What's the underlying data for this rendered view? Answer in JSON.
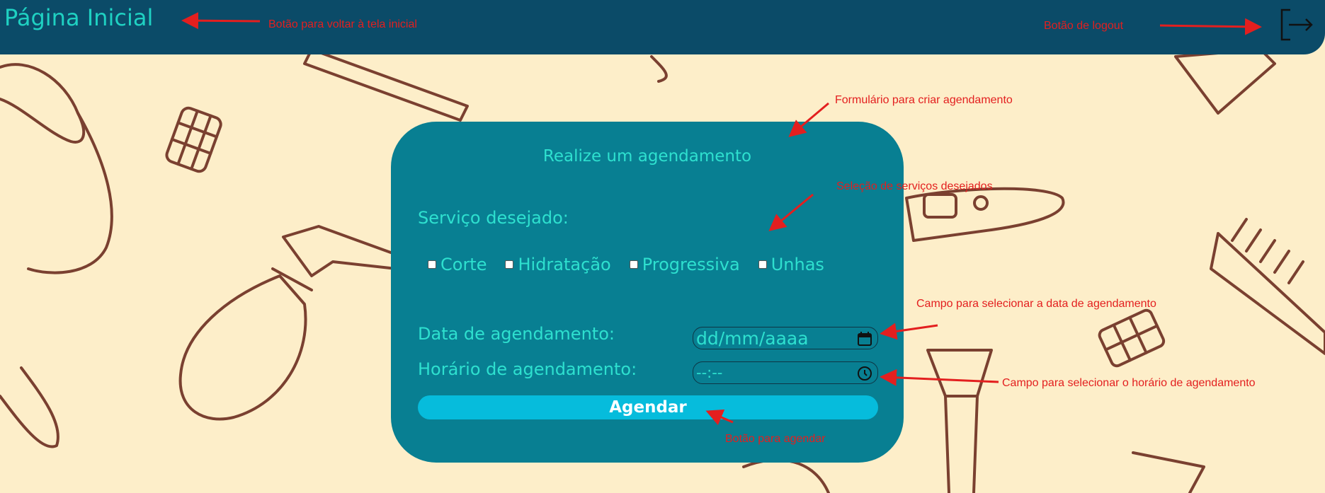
{
  "header": {
    "home_label": "Página Inicial",
    "logout_icon": "logout-icon"
  },
  "form": {
    "title": "Realize um agendamento",
    "service_label": "Serviço desejado:",
    "services": [
      {
        "label": "Corte",
        "checked": false
      },
      {
        "label": "Hidratação",
        "checked": false
      },
      {
        "label": "Progressiva",
        "checked": false
      },
      {
        "label": "Unhas",
        "checked": false
      }
    ],
    "date_label": "Data de agendamento:",
    "date_placeholder": "dd/mm/aaaa",
    "date_icon": "calendar-icon",
    "time_label": "Horário de agendamento:",
    "time_placeholder": "--:--",
    "time_icon": "clock-icon",
    "submit_label": "Agendar"
  },
  "annotations": {
    "home_button": "Botão para voltar à tela inicial",
    "logout_button": "Botão de logout",
    "form": "Formulário para criar agendamento",
    "services": "Seleção de serviços desejados",
    "date_field": "Campo para selecionar a data de agendamento",
    "time_field": "Campo para selecionar o horário de agendamento",
    "submit_button": "Botão para agendar"
  },
  "colors": {
    "background": "#fdeec9",
    "header": "#0b4b68",
    "card": "#087f92",
    "accent_text": "#2ee0cf",
    "button": "#06bcdc",
    "annotation": "#e31f1f",
    "illustration": "#7a4030"
  }
}
